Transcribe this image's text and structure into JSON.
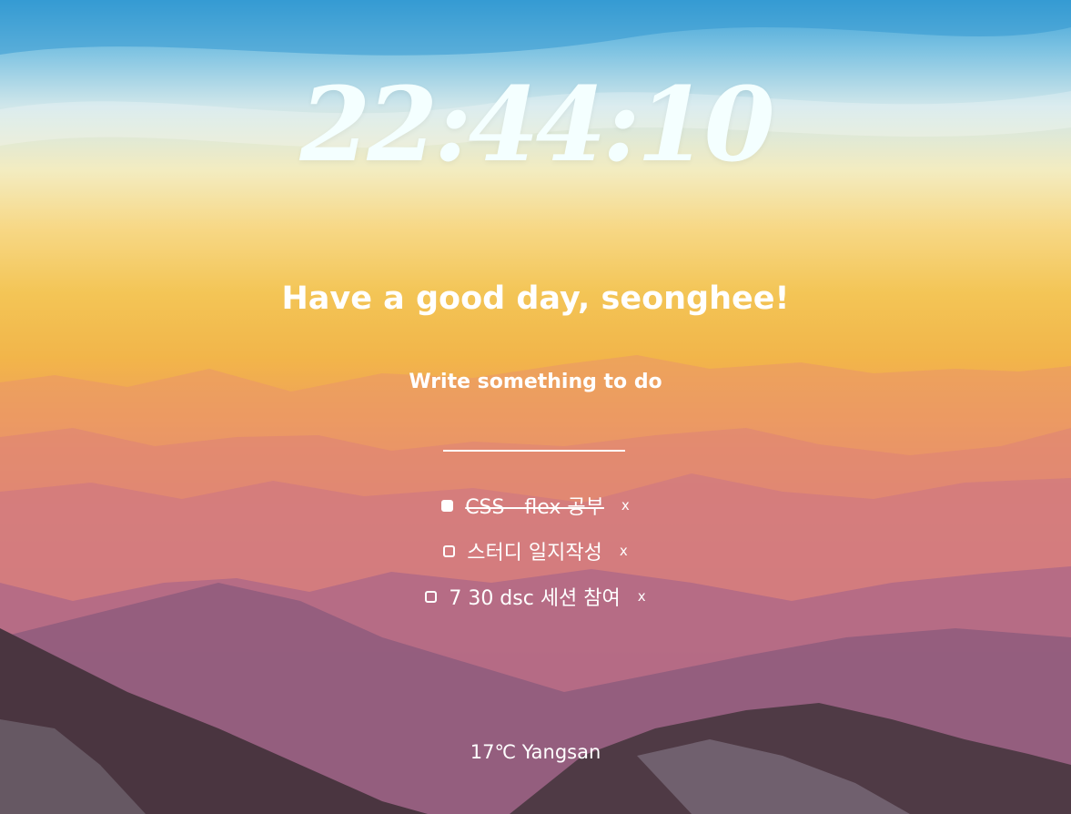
{
  "clock": {
    "time": "22:44:10"
  },
  "greeting": {
    "text": "Have a good day, seonghee!"
  },
  "todo": {
    "title": "Write something to do",
    "input_value": "",
    "items": [
      {
        "text": "CSS - flex 공부",
        "checked": true,
        "delete_label": "x"
      },
      {
        "text": "스터디 일지작성",
        "checked": false,
        "delete_label": "x"
      },
      {
        "text": "7 30 dsc 세션 참여",
        "checked": false,
        "delete_label": "x"
      }
    ]
  },
  "weather": {
    "text": "17℃ Yangsan"
  },
  "colors": {
    "text": "#ffffff",
    "clock": "#f4ffff"
  },
  "background": {
    "description_icon": "mountain-sunset-background"
  }
}
